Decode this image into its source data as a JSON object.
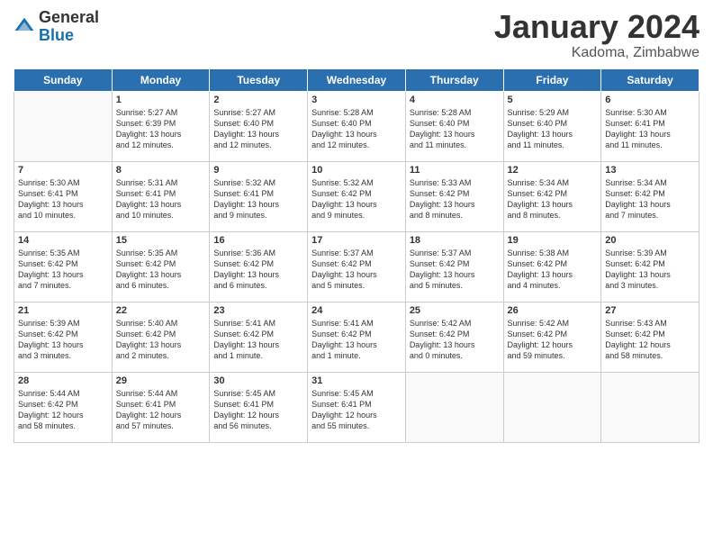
{
  "logo": {
    "general": "General",
    "blue": "Blue"
  },
  "title": "January 2024",
  "subtitle": "Kadoma, Zimbabwe",
  "headers": [
    "Sunday",
    "Monday",
    "Tuesday",
    "Wednesday",
    "Thursday",
    "Friday",
    "Saturday"
  ],
  "weeks": [
    [
      {
        "day": "",
        "content": ""
      },
      {
        "day": "1",
        "content": "Sunrise: 5:27 AM\nSunset: 6:39 PM\nDaylight: 13 hours\nand 12 minutes."
      },
      {
        "day": "2",
        "content": "Sunrise: 5:27 AM\nSunset: 6:40 PM\nDaylight: 13 hours\nand 12 minutes."
      },
      {
        "day": "3",
        "content": "Sunrise: 5:28 AM\nSunset: 6:40 PM\nDaylight: 13 hours\nand 12 minutes."
      },
      {
        "day": "4",
        "content": "Sunrise: 5:28 AM\nSunset: 6:40 PM\nDaylight: 13 hours\nand 11 minutes."
      },
      {
        "day": "5",
        "content": "Sunrise: 5:29 AM\nSunset: 6:40 PM\nDaylight: 13 hours\nand 11 minutes."
      },
      {
        "day": "6",
        "content": "Sunrise: 5:30 AM\nSunset: 6:41 PM\nDaylight: 13 hours\nand 11 minutes."
      }
    ],
    [
      {
        "day": "7",
        "content": "Sunrise: 5:30 AM\nSunset: 6:41 PM\nDaylight: 13 hours\nand 10 minutes."
      },
      {
        "day": "8",
        "content": "Sunrise: 5:31 AM\nSunset: 6:41 PM\nDaylight: 13 hours\nand 10 minutes."
      },
      {
        "day": "9",
        "content": "Sunrise: 5:32 AM\nSunset: 6:41 PM\nDaylight: 13 hours\nand 9 minutes."
      },
      {
        "day": "10",
        "content": "Sunrise: 5:32 AM\nSunset: 6:42 PM\nDaylight: 13 hours\nand 9 minutes."
      },
      {
        "day": "11",
        "content": "Sunrise: 5:33 AM\nSunset: 6:42 PM\nDaylight: 13 hours\nand 8 minutes."
      },
      {
        "day": "12",
        "content": "Sunrise: 5:34 AM\nSunset: 6:42 PM\nDaylight: 13 hours\nand 8 minutes."
      },
      {
        "day": "13",
        "content": "Sunrise: 5:34 AM\nSunset: 6:42 PM\nDaylight: 13 hours\nand 7 minutes."
      }
    ],
    [
      {
        "day": "14",
        "content": "Sunrise: 5:35 AM\nSunset: 6:42 PM\nDaylight: 13 hours\nand 7 minutes."
      },
      {
        "day": "15",
        "content": "Sunrise: 5:35 AM\nSunset: 6:42 PM\nDaylight: 13 hours\nand 6 minutes."
      },
      {
        "day": "16",
        "content": "Sunrise: 5:36 AM\nSunset: 6:42 PM\nDaylight: 13 hours\nand 6 minutes."
      },
      {
        "day": "17",
        "content": "Sunrise: 5:37 AM\nSunset: 6:42 PM\nDaylight: 13 hours\nand 5 minutes."
      },
      {
        "day": "18",
        "content": "Sunrise: 5:37 AM\nSunset: 6:42 PM\nDaylight: 13 hours\nand 5 minutes."
      },
      {
        "day": "19",
        "content": "Sunrise: 5:38 AM\nSunset: 6:42 PM\nDaylight: 13 hours\nand 4 minutes."
      },
      {
        "day": "20",
        "content": "Sunrise: 5:39 AM\nSunset: 6:42 PM\nDaylight: 13 hours\nand 3 minutes."
      }
    ],
    [
      {
        "day": "21",
        "content": "Sunrise: 5:39 AM\nSunset: 6:42 PM\nDaylight: 13 hours\nand 3 minutes."
      },
      {
        "day": "22",
        "content": "Sunrise: 5:40 AM\nSunset: 6:42 PM\nDaylight: 13 hours\nand 2 minutes."
      },
      {
        "day": "23",
        "content": "Sunrise: 5:41 AM\nSunset: 6:42 PM\nDaylight: 13 hours\nand 1 minute."
      },
      {
        "day": "24",
        "content": "Sunrise: 5:41 AM\nSunset: 6:42 PM\nDaylight: 13 hours\nand 1 minute."
      },
      {
        "day": "25",
        "content": "Sunrise: 5:42 AM\nSunset: 6:42 PM\nDaylight: 13 hours\nand 0 minutes."
      },
      {
        "day": "26",
        "content": "Sunrise: 5:42 AM\nSunset: 6:42 PM\nDaylight: 12 hours\nand 59 minutes."
      },
      {
        "day": "27",
        "content": "Sunrise: 5:43 AM\nSunset: 6:42 PM\nDaylight: 12 hours\nand 58 minutes."
      }
    ],
    [
      {
        "day": "28",
        "content": "Sunrise: 5:44 AM\nSunset: 6:42 PM\nDaylight: 12 hours\nand 58 minutes."
      },
      {
        "day": "29",
        "content": "Sunrise: 5:44 AM\nSunset: 6:41 PM\nDaylight: 12 hours\nand 57 minutes."
      },
      {
        "day": "30",
        "content": "Sunrise: 5:45 AM\nSunset: 6:41 PM\nDaylight: 12 hours\nand 56 minutes."
      },
      {
        "day": "31",
        "content": "Sunrise: 5:45 AM\nSunset: 6:41 PM\nDaylight: 12 hours\nand 55 minutes."
      },
      {
        "day": "",
        "content": ""
      },
      {
        "day": "",
        "content": ""
      },
      {
        "day": "",
        "content": ""
      }
    ]
  ]
}
